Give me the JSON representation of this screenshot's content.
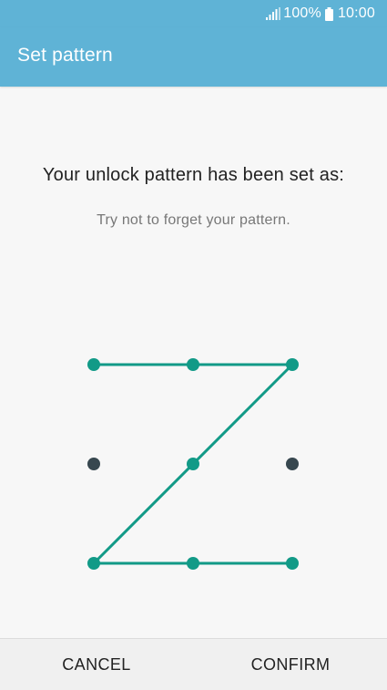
{
  "status_bar": {
    "battery": "100%",
    "time": "10:00",
    "icons": [
      "signal-icon",
      "battery-icon"
    ]
  },
  "app_bar": {
    "title": "Set pattern"
  },
  "main": {
    "heading": "Your unlock pattern has been set as:",
    "subheading": "Try not to forget your pattern."
  },
  "pattern": {
    "grid": "3x3",
    "sequence": [
      1,
      2,
      3,
      5,
      7,
      8,
      9
    ],
    "active_color": "#129a87",
    "inactive_color": "#37474f"
  },
  "footer": {
    "cancel_label": "CANCEL",
    "confirm_label": "CONFIRM"
  },
  "colors": {
    "accent": "#5fb3d6",
    "pattern": "#129a87"
  }
}
